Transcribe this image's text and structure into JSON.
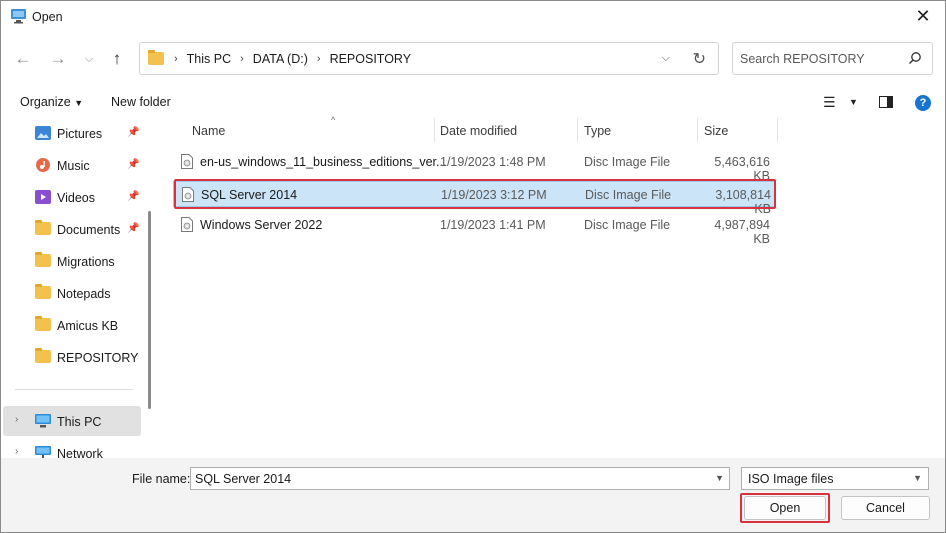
{
  "window": {
    "title": "Open"
  },
  "address": {
    "crumbs": [
      "This PC",
      "DATA (D:)",
      "REPOSITORY"
    ]
  },
  "search": {
    "placeholder": "Search REPOSITORY"
  },
  "toolbar": {
    "organize": "Organize",
    "new_folder": "New folder"
  },
  "sidebar": {
    "items": [
      {
        "label": "Pictures",
        "icon": "pictures-icon",
        "pinned": true
      },
      {
        "label": "Music",
        "icon": "music-icon",
        "pinned": true
      },
      {
        "label": "Videos",
        "icon": "videos-icon",
        "pinned": true
      },
      {
        "label": "Documents",
        "icon": "folder-icon",
        "pinned": true
      },
      {
        "label": "Migrations",
        "icon": "folder-icon",
        "pinned": false
      },
      {
        "label": "Notepads",
        "icon": "folder-icon",
        "pinned": false
      },
      {
        "label": "Amicus KB",
        "icon": "folder-icon",
        "pinned": false
      },
      {
        "label": "REPOSITORY",
        "icon": "folder-icon",
        "pinned": false
      }
    ],
    "this_pc": "This PC",
    "network": "Network"
  },
  "columns": {
    "name": "Name",
    "date": "Date modified",
    "type": "Type",
    "size": "Size"
  },
  "files": [
    {
      "name": "en-us_windows_11_business_editions_ver...",
      "date": "1/19/2023 1:48 PM",
      "type": "Disc Image File",
      "size": "5,463,616 KB",
      "selected": false
    },
    {
      "name": "SQL Server 2014",
      "date": "1/19/2023 3:12 PM",
      "type": "Disc Image File",
      "size": "3,108,814 KB",
      "selected": true
    },
    {
      "name": "Windows Server 2022",
      "date": "1/19/2023 1:41 PM",
      "type": "Disc Image File",
      "size": "4,987,894 KB",
      "selected": false
    }
  ],
  "footer": {
    "file_name_label": "File name:",
    "file_name_value": "SQL Server 2014",
    "file_type": "ISO Image files",
    "open_button": "Open",
    "cancel_button": "Cancel"
  },
  "colors": {
    "selection": "#cce4f7",
    "highlight": "#d8333c",
    "help": "#1874d2"
  }
}
